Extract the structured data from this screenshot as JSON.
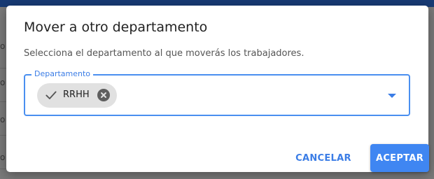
{
  "background": {
    "row_glyph": "o"
  },
  "dialog": {
    "title": "Mover a otro departamento",
    "description": "Selecciona el departamento al que moverás los trabajadores.",
    "field": {
      "label": "Departamento",
      "selected_chip": "RRHH",
      "chip_icon": "check-icon",
      "chip_remove_icon": "close-circle-icon",
      "dropdown_icon": "caret-down-icon"
    },
    "actions": {
      "cancel_label": "CANCELAR",
      "accept_label": "ACEPTAR"
    }
  },
  "colors": {
    "accent": "#3f86f2",
    "topbar": "#173a74",
    "chip_bg": "#e1e1e1"
  }
}
